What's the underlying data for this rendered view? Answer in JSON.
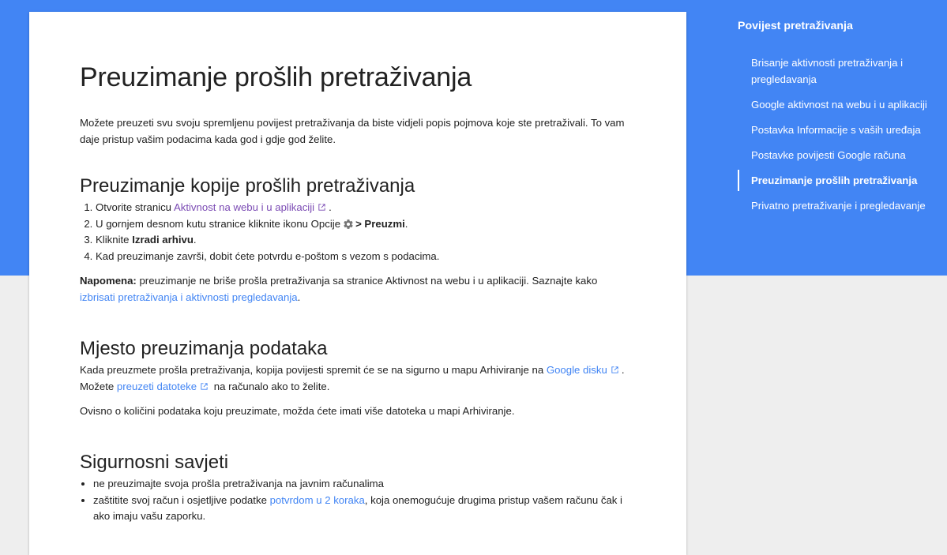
{
  "colors": {
    "brand_blue": "#4285f4",
    "link": "#4285f4",
    "visited_link": "#7b4bb4",
    "background": "#eeeeee"
  },
  "article": {
    "title": "Preuzimanje prošlih pretraživanja",
    "intro": "Možete preuzeti svu svoju spremljenu povijest pretraživanja da biste vidjeli popis pojmova koje ste pretraživali. To vam daje pristup vašim podacima kada god i gdje god želite.",
    "section1": {
      "heading": "Preuzimanje kopije prošlih pretraživanja",
      "step1_prefix": "Otvorite stranicu ",
      "step1_link": "Aktivnost na webu i u aplikaciji",
      "step1_suffix": ".",
      "step2_prefix": "U gornjem desnom kutu stranice kliknite ikonu Opcije",
      "step2_bold": "> Preuzmi",
      "step2_suffix": ".",
      "step3_prefix": "Kliknite ",
      "step3_bold": "Izradi arhivu",
      "step3_suffix": ".",
      "step4": "Kad preuzimanje završi, dobit ćete potvrdu e-poštom s vezom s podacima.",
      "note_label": "Napomena:",
      "note_text": " preuzimanje ne briše prošla pretraživanja sa stranice Aktivnost na webu i u aplikaciji. Saznajte kako ",
      "note_link": "izbrisati pretraživanja i aktivnosti pregledavanja",
      "note_suffix": "."
    },
    "section2": {
      "heading": "Mjesto preuzimanja podataka",
      "p1_prefix": "Kada preuzmete prošla pretraživanja, kopija povijesti spremit će se na sigurno u mapu Arhiviranje na ",
      "p1_link": "Google disku",
      "p1_mid": ". Možete ",
      "p1_link2": "preuzeti datoteke",
      "p1_suffix": " na računalo ako to želite.",
      "p2": "Ovisno o količini podataka koju preuzimate, možda ćete imati više datoteka u mapi Arhiviranje."
    },
    "section3": {
      "heading": "Sigurnosni savjeti",
      "tip1": "ne preuzimajte svoja prošla pretraživanja na javnim računalima",
      "tip2_prefix": "zaštitite svoj račun i osjetljive podatke ",
      "tip2_link": "potvrdom u 2 koraka",
      "tip2_suffix": ", koja onemogućuje drugima pristup vašem računu čak i ako imaju vašu zaporku."
    }
  },
  "sidebar": {
    "title": "Povijest pretraživanja",
    "items": [
      {
        "label": "Brisanje aktivnosti pretraživanja i pregledavanja"
      },
      {
        "label": "Google aktivnost na webu i u aplikaciji"
      },
      {
        "label": "Postavka Informacije s vaših uređaja"
      },
      {
        "label": "Postavke povijesti Google računa"
      },
      {
        "label": "Preuzimanje prošlih pretraživanja",
        "active": true
      },
      {
        "label": "Privatno pretraživanje i pregledavanje"
      }
    ]
  }
}
